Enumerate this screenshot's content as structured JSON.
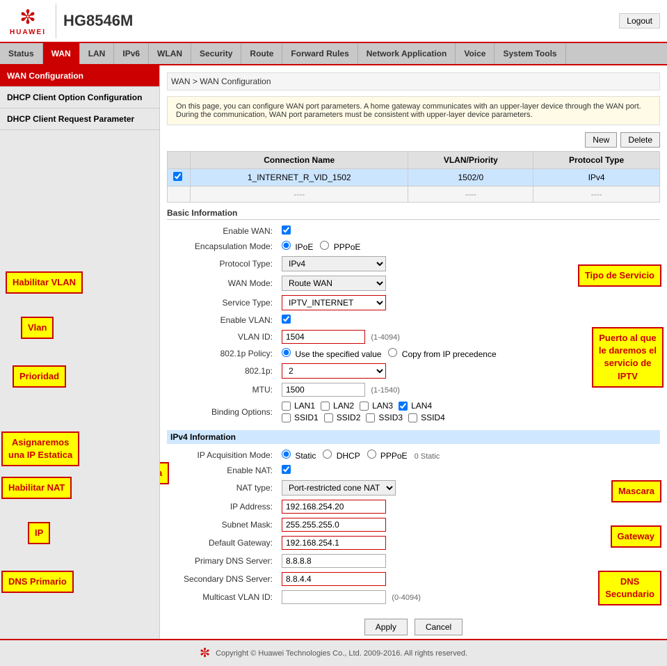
{
  "header": {
    "device_name": "HG8546M",
    "logout_label": "Logout",
    "logo_text": "HUAWEI"
  },
  "nav": {
    "items": [
      {
        "label": "Status",
        "active": false
      },
      {
        "label": "WAN",
        "active": true
      },
      {
        "label": "LAN",
        "active": false
      },
      {
        "label": "IPv6",
        "active": false
      },
      {
        "label": "WLAN",
        "active": false
      },
      {
        "label": "Security",
        "active": false
      },
      {
        "label": "Route",
        "active": false
      },
      {
        "label": "Forward Rules",
        "active": false
      },
      {
        "label": "Network Application",
        "active": false
      },
      {
        "label": "Voice",
        "active": false
      },
      {
        "label": "System Tools",
        "active": false
      }
    ]
  },
  "sidebar": {
    "items": [
      {
        "label": "WAN Configuration",
        "active": true
      },
      {
        "label": "DHCP Client Option Configuration",
        "active": false
      },
      {
        "label": "DHCP Client Request Parameter",
        "active": false
      }
    ]
  },
  "breadcrumb": "WAN > WAN Configuration",
  "info_text": "On this page, you can configure WAN port parameters. A home gateway communicates with an upper-layer device through the WAN port. During the communication, WAN port parameters must be consistent with upper-layer device parameters.",
  "buttons": {
    "new": "New",
    "delete": "Delete"
  },
  "table": {
    "headers": [
      "",
      "Connection Name",
      "VLAN/Priority",
      "Protocol Type"
    ],
    "rows": [
      {
        "checkbox": true,
        "name": "1_INTERNET_R_VID_1502",
        "vlan": "1502/0",
        "protocol": "IPv4"
      },
      {
        "checkbox": false,
        "name": "----",
        "vlan": "----",
        "protocol": "----"
      }
    ]
  },
  "basic_info": {
    "title": "Basic Information",
    "enable_wan_label": "Enable WAN:",
    "encap_label": "Encapsulation Mode:",
    "encap_options": [
      "IPoE",
      "PPPoE"
    ],
    "encap_selected": "IPoE",
    "protocol_label": "Protocol Type:",
    "protocol_value": "IPv4",
    "wan_mode_label": "WAN Mode:",
    "wan_mode_value": "Route WAN",
    "service_type_label": "Service Type:",
    "service_type_value": "IPTV_INTERNET",
    "enable_vlan_label": "Enable VLAN:",
    "vlan_id_label": "VLAN ID:",
    "vlan_id_value": "1504",
    "vlan_id_hint": "(1-4094)",
    "policy_label": "802.1p Policy:",
    "policy_options": [
      "Use the specified value",
      "Copy from IP precedence"
    ],
    "policy_selected": "Use the specified value",
    "dot1p_label": "802.1p:",
    "dot1p_value": "2",
    "mtu_label": "MTU:",
    "mtu_value": "1500",
    "mtu_hint": "(1-1540)",
    "binding_label": "Binding Options:",
    "binding_opts": [
      "LAN1",
      "LAN2",
      "LAN3",
      "LAN4",
      "SSID1",
      "SSID2",
      "SSID3",
      "SSID4"
    ],
    "lan4_checked": true
  },
  "ipv4_info": {
    "title": "IPv4 Information",
    "acq_label": "IP Acquisition Mode:",
    "acq_options": [
      "Static",
      "DHCP",
      "PPPoE"
    ],
    "acq_selected": "Static",
    "static_count": "0 Static",
    "enable_nat_label": "Enable NAT:",
    "nat_type_label": "NAT type:",
    "nat_type_value": "Port-restricted cone NAT",
    "ip_label": "IP Address:",
    "ip_value": "192.168.254.20",
    "subnet_label": "Subnet Mask:",
    "subnet_value": "255.255.255.0",
    "gateway_label": "Default Gateway:",
    "gateway_value": "192.168.254.1",
    "dns1_label": "Primary DNS Server:",
    "dns1_value": "8.8.8.8",
    "dns2_label": "Secondary DNS Server:",
    "dns2_value": "8.8.4.4",
    "multicast_label": "Multicast VLAN ID:",
    "multicast_value": "",
    "multicast_hint": "(0-4094)"
  },
  "action_buttons": {
    "apply": "Apply",
    "cancel": "Cancel"
  },
  "footer": {
    "text": "Copyright © Huawei Technologies Co., Ltd. 2009-2016. All rights reserved."
  },
  "annotations": {
    "habilitar_vlan": "Habilitar VLAN",
    "vlan": "Vlan",
    "prioridad": "Prioridad",
    "asignar_ip": "Asignaremos\nuna IP Estatica",
    "habilitar_nat": "Habilitar NAT",
    "ip": "IP",
    "dns_primario": "DNS Primario",
    "tipo_servicio": "Tipo de Servicio",
    "puerto_iptv": "Puerto al que\nle daremos el\nservicio de\nIPTV",
    "mascara": "Mascara",
    "gateway": "Gateway",
    "dns_secundario": "DNS\nSecundario"
  }
}
